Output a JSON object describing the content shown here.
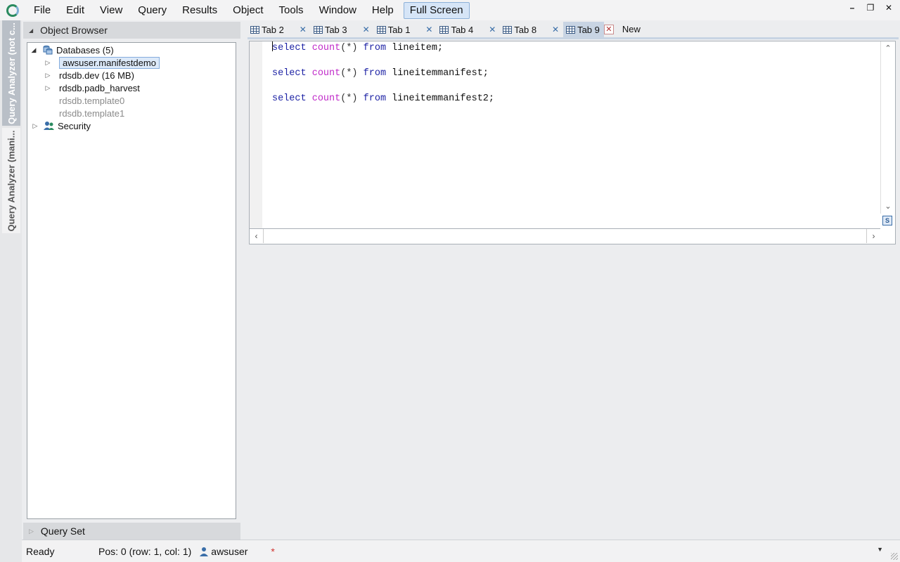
{
  "menubar": {
    "items": [
      "File",
      "Edit",
      "View",
      "Query",
      "Results",
      "Object",
      "Tools",
      "Window",
      "Help"
    ],
    "fullscreen_label": "Full Screen"
  },
  "vtabs": {
    "tab1": "Query Analyzer (not c...",
    "tab2": "Query Analyzer (mani..."
  },
  "object_browser": {
    "title": "Object Browser",
    "tree": {
      "databases_label": "Databases (5)",
      "databases": [
        {
          "label": "awsuser.manifestdemo",
          "selected": true,
          "expandable": true
        },
        {
          "label": "rdsdb.dev (16 MB)",
          "expandable": true
        },
        {
          "label": "rdsdb.padb_harvest",
          "expandable": true
        },
        {
          "label": "rdsdb.template0",
          "dim": true
        },
        {
          "label": "rdsdb.template1",
          "dim": true
        }
      ],
      "security_label": "Security"
    }
  },
  "query_set": {
    "title": "Query Set"
  },
  "tabs": [
    {
      "label": "Tab 2"
    },
    {
      "label": "Tab 3"
    },
    {
      "label": "Tab 1"
    },
    {
      "label": "Tab 4"
    },
    {
      "label": "Tab 8"
    },
    {
      "label": "Tab 9",
      "active": true
    }
  ],
  "new_tab_label": "New",
  "editor": {
    "lines": [
      {
        "kw1": "select",
        "fn": "count",
        "args": "(*)",
        "kw2": "from",
        "table": "lineitem;"
      },
      {
        "kw1": "select",
        "fn": "count",
        "args": "(*)",
        "kw2": "from",
        "table": "lineitemmanifest;"
      },
      {
        "kw1": "select",
        "fn": "count",
        "args": "(*)",
        "kw2": "from",
        "table": "lineitemmanifest2;"
      }
    ]
  },
  "status": {
    "state": "Ready",
    "position": "Pos: 0 (row: 1, col: 1)",
    "user": "awsuser",
    "dirty_marker": "*"
  },
  "colors": {
    "keyword": "#1e23a5",
    "function": "#c02ac9",
    "selection": "#dce9f9",
    "active_tab": "#c8d4e3"
  }
}
